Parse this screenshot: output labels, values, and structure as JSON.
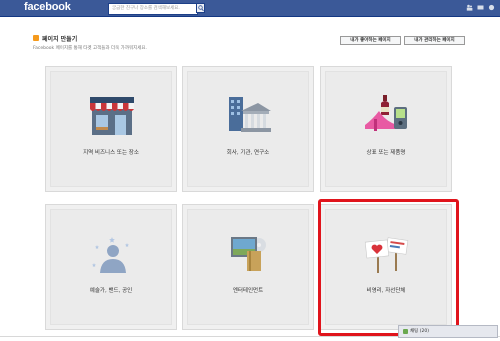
{
  "header": {
    "logo": "facebook",
    "search_placeholder": "궁금한 친구나 장소를 검색해보세요."
  },
  "page": {
    "title": "페이지 만들기",
    "subtitle": "Facebook 페이지를 통해 타겟 고객들과 더욱 가까워지세요.",
    "liked_pages_button": "내가 좋아하는 페이지",
    "managed_pages_button": "내가 관리하는 페이지"
  },
  "categories": [
    {
      "label": "지역 비즈니스 또는 장소",
      "icon": "storefront-icon"
    },
    {
      "label": "회사, 기관, 연구소",
      "icon": "company-buildings-icon"
    },
    {
      "label": "상표 또는 제품명",
      "icon": "brand-products-icon"
    },
    {
      "label": "예술가, 밴드, 공인",
      "icon": "artist-silhouette-icon"
    },
    {
      "label": "엔터테인먼트",
      "icon": "entertainment-icon"
    },
    {
      "label": "비영리, 자선단체",
      "icon": "cause-signs-icon"
    }
  ],
  "chat": {
    "label": "채팅 (20)"
  },
  "colors": {
    "header": "#3b5998",
    "highlight": "#e0141c"
  }
}
